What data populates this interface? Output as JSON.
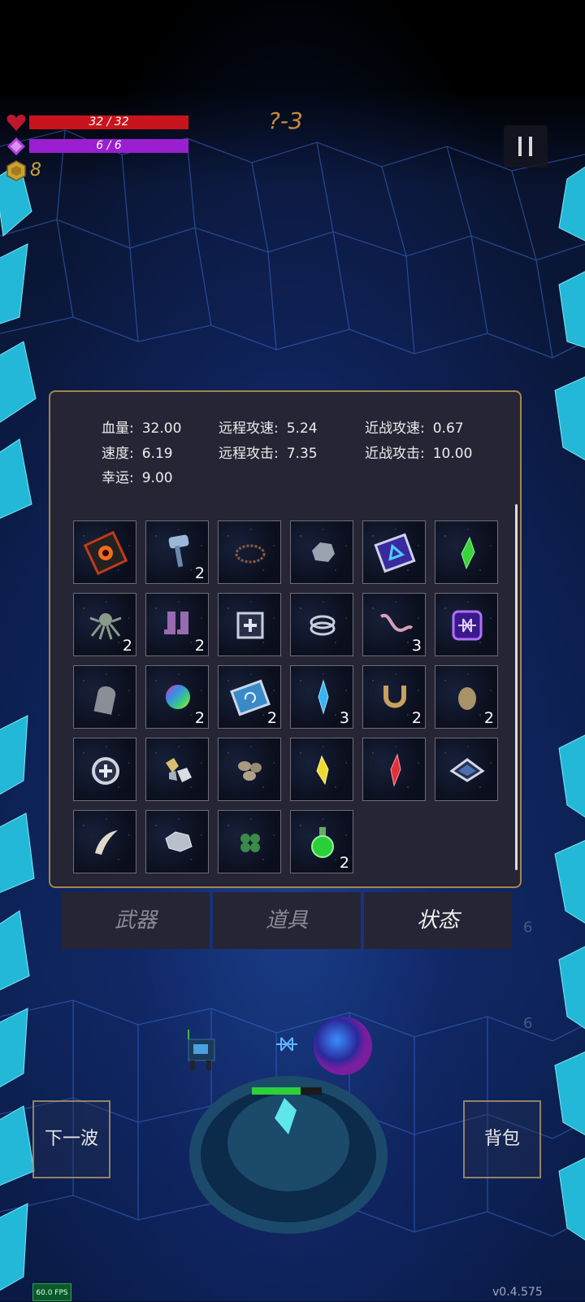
{
  "hud": {
    "hp_text": "32 / 32",
    "mp_text": "6 / 6",
    "gold": "8",
    "level": "?-3",
    "hp_color": "#c8141c",
    "mp_color": "#9b1fd0"
  },
  "stats": {
    "hp": {
      "label": "血量:",
      "value": "32.00"
    },
    "speed": {
      "label": "速度:",
      "value": "6.19"
    },
    "luck": {
      "label": "幸运:",
      "value": "9.00"
    },
    "ranged_speed": {
      "label": "远程攻速:",
      "value": "5.24"
    },
    "ranged_attack": {
      "label": "远程攻击:",
      "value": "7.35"
    },
    "melee_speed": {
      "label": "近战攻速:",
      "value": "0.67"
    },
    "melee_attack": {
      "label": "近战攻击:",
      "value": "10.00"
    }
  },
  "items": [
    {
      "icon": "flame-book-icon",
      "count": ""
    },
    {
      "icon": "hammer-icon",
      "count": "2"
    },
    {
      "icon": "thorn-crown-icon",
      "count": ""
    },
    {
      "icon": "gray-rock-icon",
      "count": ""
    },
    {
      "icon": "blue-rune-book-icon",
      "count": ""
    },
    {
      "icon": "green-crystal-icon",
      "count": ""
    },
    {
      "icon": "octopus-icon",
      "count": "2"
    },
    {
      "icon": "boots-icon",
      "count": "2"
    },
    {
      "icon": "medkit-icon",
      "count": ""
    },
    {
      "icon": "silver-ring-icon",
      "count": ""
    },
    {
      "icon": "worm-icon",
      "count": "3"
    },
    {
      "icon": "purple-rune-icon",
      "count": ""
    },
    {
      "icon": "tombstone-icon",
      "count": ""
    },
    {
      "icon": "rainbow-orb-icon",
      "count": "2"
    },
    {
      "icon": "spiral-book-icon",
      "count": "2"
    },
    {
      "icon": "blue-crystal-icon",
      "count": "3"
    },
    {
      "icon": "horseshoe-icon",
      "count": "2"
    },
    {
      "icon": "egg-icon",
      "count": "2"
    },
    {
      "icon": "cross-ring-icon",
      "count": ""
    },
    {
      "icon": "gold-ore-icon",
      "count": ""
    },
    {
      "icon": "bone-pile-icon",
      "count": ""
    },
    {
      "icon": "yellow-crystal-icon",
      "count": ""
    },
    {
      "icon": "red-crystal-icon",
      "count": ""
    },
    {
      "icon": "diamond-plate-icon",
      "count": ""
    },
    {
      "icon": "fang-icon",
      "count": ""
    },
    {
      "icon": "silver-ore-icon",
      "count": ""
    },
    {
      "icon": "clover-icon",
      "count": ""
    },
    {
      "icon": "green-potion-icon",
      "count": "2"
    }
  ],
  "tabs": [
    {
      "label": "武器",
      "active": false
    },
    {
      "label": "道具",
      "active": false
    },
    {
      "label": "状态",
      "active": true
    }
  ],
  "buttons": {
    "next_wave": "下一波",
    "backpack": "背包"
  },
  "background_numbers": [
    "6",
    "6"
  ],
  "fps": "60.0 FPS",
  "version": "v0.4.575"
}
